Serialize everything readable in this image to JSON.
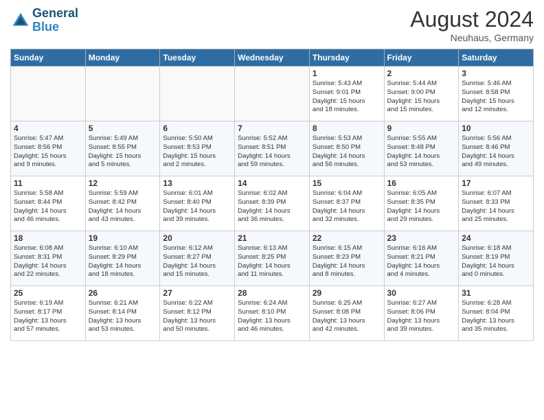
{
  "header": {
    "logo_line1": "General",
    "logo_line2": "Blue",
    "month_year": "August 2024",
    "location": "Neuhaus, Germany"
  },
  "weekdays": [
    "Sunday",
    "Monday",
    "Tuesday",
    "Wednesday",
    "Thursday",
    "Friday",
    "Saturday"
  ],
  "weeks": [
    [
      {
        "day": "",
        "info": ""
      },
      {
        "day": "",
        "info": ""
      },
      {
        "day": "",
        "info": ""
      },
      {
        "day": "",
        "info": ""
      },
      {
        "day": "1",
        "info": "Sunrise: 5:43 AM\nSunset: 9:01 PM\nDaylight: 15 hours\nand 18 minutes."
      },
      {
        "day": "2",
        "info": "Sunrise: 5:44 AM\nSunset: 9:00 PM\nDaylight: 15 hours\nand 15 minutes."
      },
      {
        "day": "3",
        "info": "Sunrise: 5:46 AM\nSunset: 8:58 PM\nDaylight: 15 hours\nand 12 minutes."
      }
    ],
    [
      {
        "day": "4",
        "info": "Sunrise: 5:47 AM\nSunset: 8:56 PM\nDaylight: 15 hours\nand 9 minutes."
      },
      {
        "day": "5",
        "info": "Sunrise: 5:49 AM\nSunset: 8:55 PM\nDaylight: 15 hours\nand 5 minutes."
      },
      {
        "day": "6",
        "info": "Sunrise: 5:50 AM\nSunset: 8:53 PM\nDaylight: 15 hours\nand 2 minutes."
      },
      {
        "day": "7",
        "info": "Sunrise: 5:52 AM\nSunset: 8:51 PM\nDaylight: 14 hours\nand 59 minutes."
      },
      {
        "day": "8",
        "info": "Sunrise: 5:53 AM\nSunset: 8:50 PM\nDaylight: 14 hours\nand 56 minutes."
      },
      {
        "day": "9",
        "info": "Sunrise: 5:55 AM\nSunset: 8:48 PM\nDaylight: 14 hours\nand 53 minutes."
      },
      {
        "day": "10",
        "info": "Sunrise: 5:56 AM\nSunset: 8:46 PM\nDaylight: 14 hours\nand 49 minutes."
      }
    ],
    [
      {
        "day": "11",
        "info": "Sunrise: 5:58 AM\nSunset: 8:44 PM\nDaylight: 14 hours\nand 46 minutes."
      },
      {
        "day": "12",
        "info": "Sunrise: 5:59 AM\nSunset: 8:42 PM\nDaylight: 14 hours\nand 43 minutes."
      },
      {
        "day": "13",
        "info": "Sunrise: 6:01 AM\nSunset: 8:40 PM\nDaylight: 14 hours\nand 39 minutes."
      },
      {
        "day": "14",
        "info": "Sunrise: 6:02 AM\nSunset: 8:39 PM\nDaylight: 14 hours\nand 36 minutes."
      },
      {
        "day": "15",
        "info": "Sunrise: 6:04 AM\nSunset: 8:37 PM\nDaylight: 14 hours\nand 32 minutes."
      },
      {
        "day": "16",
        "info": "Sunrise: 6:05 AM\nSunset: 8:35 PM\nDaylight: 14 hours\nand 29 minutes."
      },
      {
        "day": "17",
        "info": "Sunrise: 6:07 AM\nSunset: 8:33 PM\nDaylight: 14 hours\nand 25 minutes."
      }
    ],
    [
      {
        "day": "18",
        "info": "Sunrise: 6:08 AM\nSunset: 8:31 PM\nDaylight: 14 hours\nand 22 minutes."
      },
      {
        "day": "19",
        "info": "Sunrise: 6:10 AM\nSunset: 8:29 PM\nDaylight: 14 hours\nand 18 minutes."
      },
      {
        "day": "20",
        "info": "Sunrise: 6:12 AM\nSunset: 8:27 PM\nDaylight: 14 hours\nand 15 minutes."
      },
      {
        "day": "21",
        "info": "Sunrise: 6:13 AM\nSunset: 8:25 PM\nDaylight: 14 hours\nand 11 minutes."
      },
      {
        "day": "22",
        "info": "Sunrise: 6:15 AM\nSunset: 8:23 PM\nDaylight: 14 hours\nand 8 minutes."
      },
      {
        "day": "23",
        "info": "Sunrise: 6:16 AM\nSunset: 8:21 PM\nDaylight: 14 hours\nand 4 minutes."
      },
      {
        "day": "24",
        "info": "Sunrise: 6:18 AM\nSunset: 8:19 PM\nDaylight: 14 hours\nand 0 minutes."
      }
    ],
    [
      {
        "day": "25",
        "info": "Sunrise: 6:19 AM\nSunset: 8:17 PM\nDaylight: 13 hours\nand 57 minutes."
      },
      {
        "day": "26",
        "info": "Sunrise: 6:21 AM\nSunset: 8:14 PM\nDaylight: 13 hours\nand 53 minutes."
      },
      {
        "day": "27",
        "info": "Sunrise: 6:22 AM\nSunset: 8:12 PM\nDaylight: 13 hours\nand 50 minutes."
      },
      {
        "day": "28",
        "info": "Sunrise: 6:24 AM\nSunset: 8:10 PM\nDaylight: 13 hours\nand 46 minutes."
      },
      {
        "day": "29",
        "info": "Sunrise: 6:25 AM\nSunset: 8:08 PM\nDaylight: 13 hours\nand 42 minutes."
      },
      {
        "day": "30",
        "info": "Sunrise: 6:27 AM\nSunset: 8:06 PM\nDaylight: 13 hours\nand 39 minutes."
      },
      {
        "day": "31",
        "info": "Sunrise: 6:28 AM\nSunset: 8:04 PM\nDaylight: 13 hours\nand 35 minutes."
      }
    ]
  ]
}
